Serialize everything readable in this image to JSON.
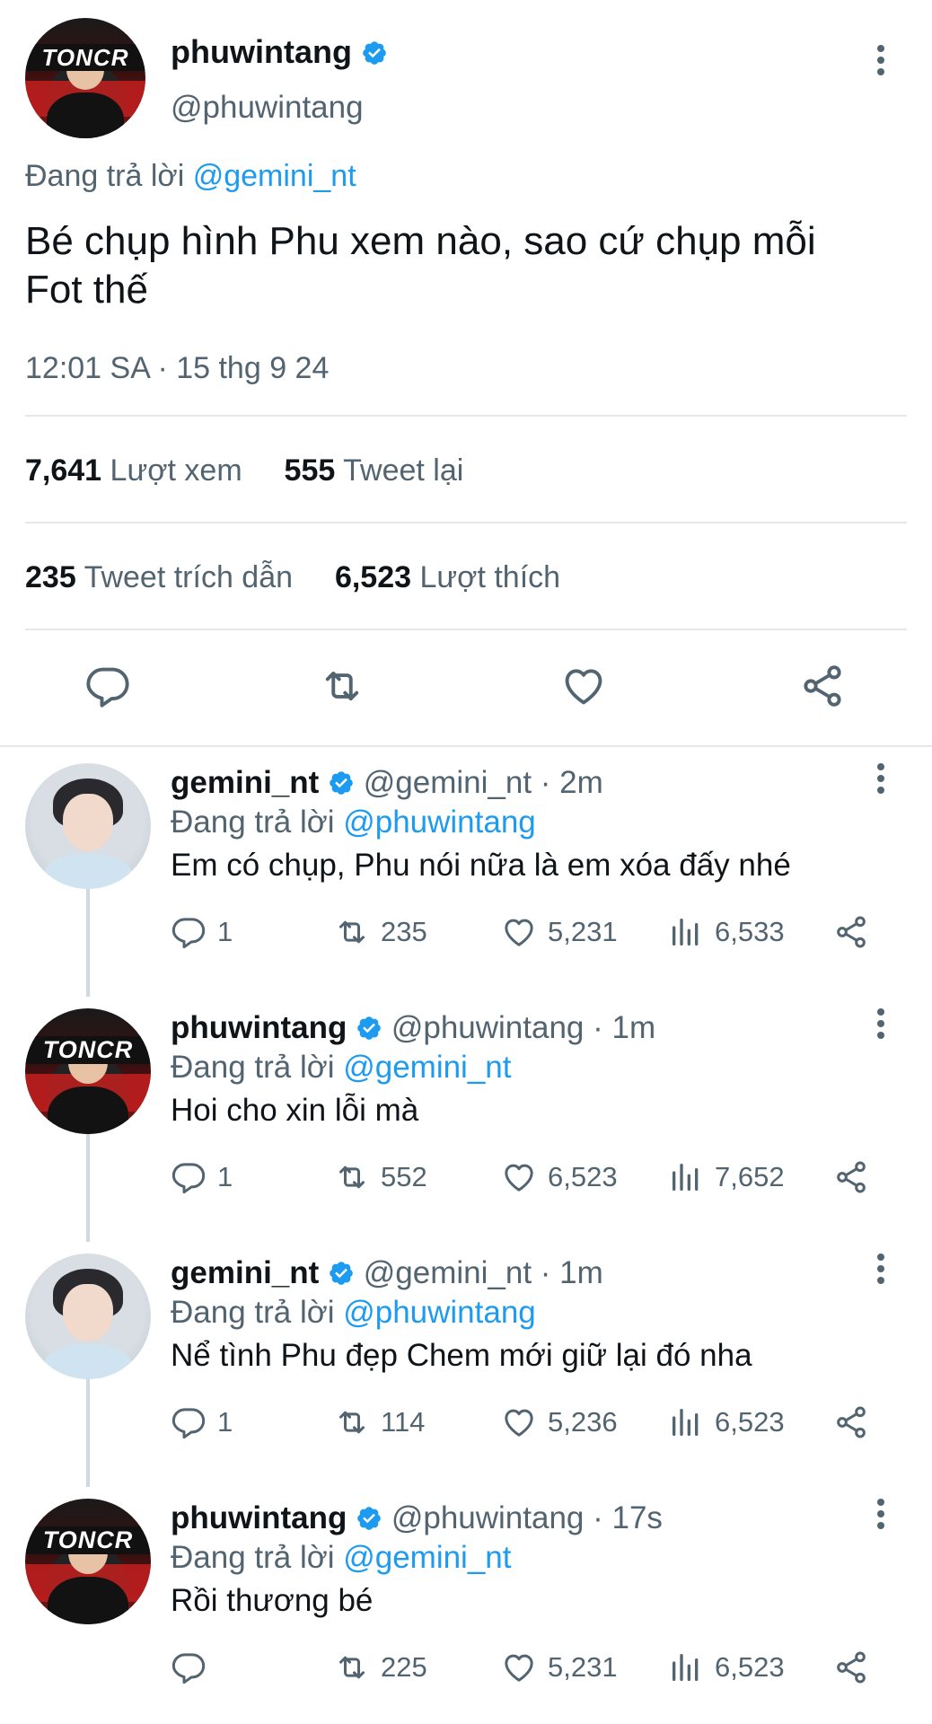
{
  "main_tweet": {
    "display_name": "phuwintang",
    "handle": "@phuwintang",
    "reply_label": "Đang trả lời",
    "reply_to": "@gemini_nt",
    "text_line1": "Bé chụp hình Phu xem nào, sao cứ chụp mỗi",
    "text_line2": "Fot thế",
    "timestamp": "12:01 SA · 15 thg 9 24",
    "stats": {
      "views_count": "7,641",
      "views_label": "Lượt xem",
      "retweets_count": "555",
      "retweets_label": "Tweet lại",
      "quotes_count": "235",
      "quotes_label": "Tweet trích dẫn",
      "likes_count": "6,523",
      "likes_label": "Lượt thích"
    },
    "avatar_banner": "TONCR"
  },
  "replies": [
    {
      "display_name": "gemini_nt",
      "handle_time": "@gemini_nt · 2m",
      "reply_label": "Đang trả lời",
      "reply_to": "@phuwintang",
      "text": "Em có chụp, Phu nói nữa là em xóa đấy nhé",
      "reply_count": "1",
      "retweet_count": "235",
      "like_count": "5,231",
      "view_count": "6,533"
    },
    {
      "display_name": "phuwintang",
      "handle_time": "@phuwintang · 1m",
      "reply_label": "Đang trả lời",
      "reply_to": "@gemini_nt",
      "text": "Hoi cho xin lỗi mà",
      "reply_count": "1",
      "retweet_count": "552",
      "like_count": "6,523",
      "view_count": "7,652"
    },
    {
      "display_name": "gemini_nt",
      "handle_time": "@gemini_nt · 1m",
      "reply_label": "Đang trả lời",
      "reply_to": "@phuwintang",
      "text": "Nể tình Phu đẹp Chem mới giữ lại đó nha",
      "reply_count": "1",
      "retweet_count": "114",
      "like_count": "5,236",
      "view_count": "6,523"
    },
    {
      "display_name": "phuwintang",
      "handle_time": "@phuwintang · 17s",
      "reply_label": "Đang trả lời",
      "reply_to": "@gemini_nt",
      "text": "Rồi thương bé",
      "reply_count": "",
      "retweet_count": "225",
      "like_count": "5,231",
      "view_count": "6,523"
    }
  ],
  "icons": {
    "verified": "verified-badge-icon",
    "reply": "reply-icon",
    "retweet": "retweet-icon",
    "like": "heart-icon",
    "views": "views-icon",
    "share": "share-icon",
    "more": "more-icon"
  },
  "colors": {
    "accent_blue": "#1d9bf0",
    "secondary_text": "#536471",
    "primary_text": "#0f1419",
    "divider": "#e6e9ec"
  }
}
